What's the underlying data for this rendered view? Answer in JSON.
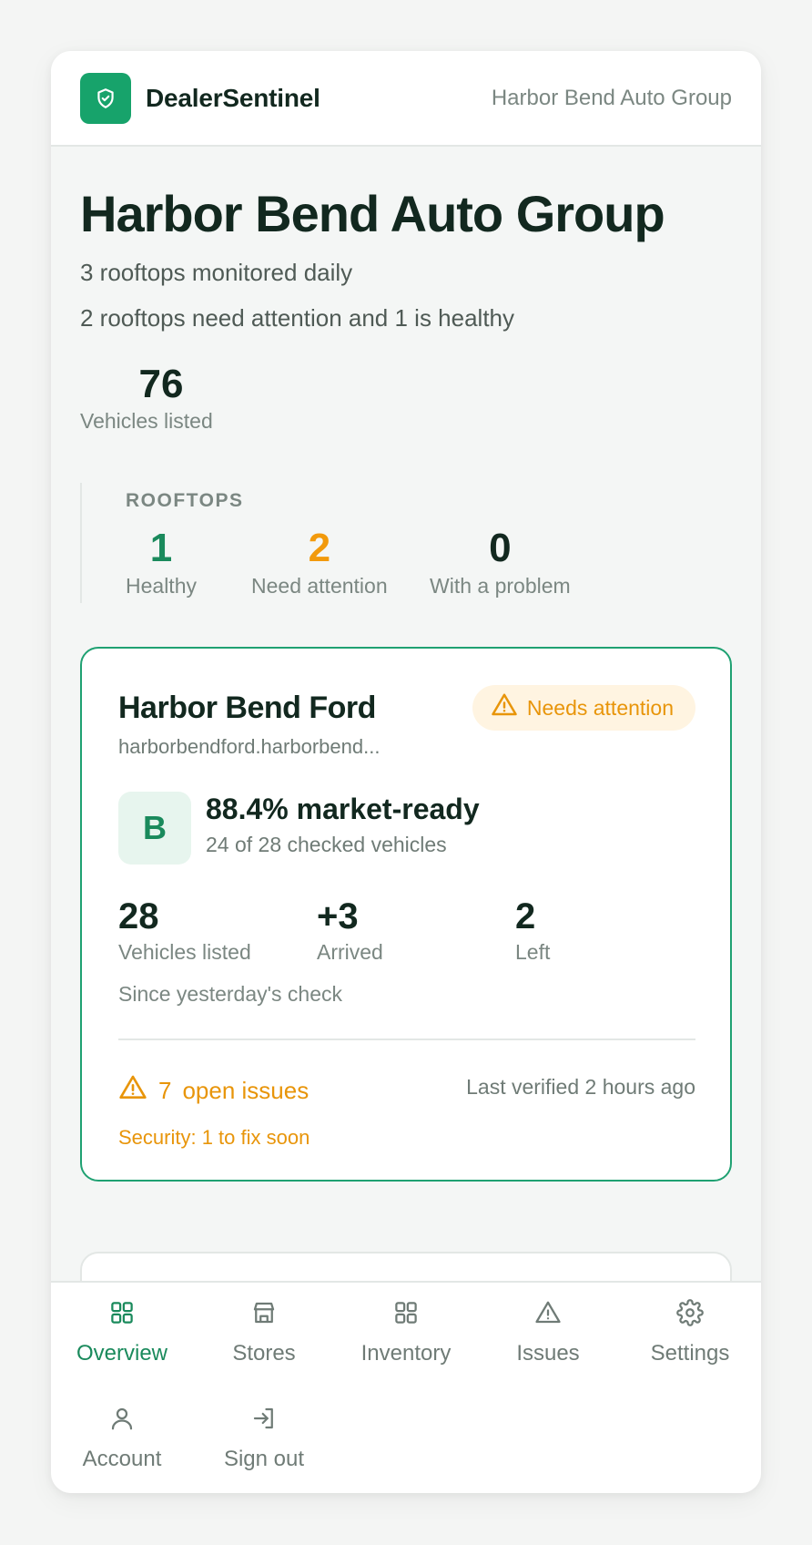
{
  "header": {
    "brand": "DealerSentinel",
    "org_link": "Harbor Bend Auto Group"
  },
  "overview": {
    "title": "Harbor Bend Auto Group",
    "subtitle": "3 rooftops monitored daily",
    "status_summary": "2 rooftops need attention and 1 is healthy",
    "vehicles_listed": {
      "value": "76",
      "label": "Vehicles listed"
    },
    "rooftops": {
      "heading": "ROOFTOPS",
      "healthy": {
        "value": "1",
        "label": "Healthy"
      },
      "attention": {
        "value": "2",
        "label": "Need attention"
      },
      "problem": {
        "value": "0",
        "label": "With a problem"
      }
    }
  },
  "store_card": {
    "name": "Harbor Bend Ford",
    "url": "harborbendford.harborbend...",
    "status_badge": "Needs attention",
    "grade": "B",
    "market_ready": "88.4% market-ready",
    "checked": "24 of 28 checked vehicles",
    "metrics": [
      {
        "value": "28",
        "label": "Vehicles listed"
      },
      {
        "value": "+3",
        "label": "Arrived"
      },
      {
        "value": "2",
        "label": "Left"
      }
    ],
    "since": "Since yesterday's check",
    "open_issues_count": "7",
    "open_issues_label": "open issues",
    "last_verified": "Last verified 2 hours ago",
    "security": "Security: 1 to fix soon"
  },
  "nav": {
    "items": [
      {
        "label": "Overview",
        "icon": "grid-icon",
        "active": true
      },
      {
        "label": "Stores",
        "icon": "store-icon"
      },
      {
        "label": "Inventory",
        "icon": "grid-icon"
      },
      {
        "label": "Issues",
        "icon": "warning-icon"
      },
      {
        "label": "Settings",
        "icon": "gear-icon"
      },
      {
        "label": "Account",
        "icon": "user-icon"
      },
      {
        "label": "Sign out",
        "icon": "sign-out-icon"
      }
    ]
  },
  "colors": {
    "brand": "#17a36b",
    "healthy": "#1a8a5c",
    "warning": "#f29a0c",
    "text": "#12281f",
    "muted": "#7b8782"
  }
}
